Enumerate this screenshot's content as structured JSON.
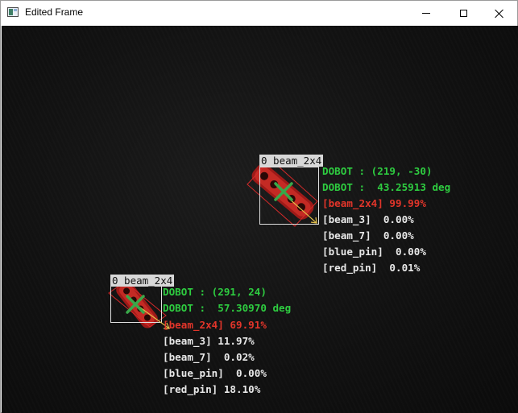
{
  "window": {
    "title": "Edited Frame",
    "icon": "app-window-icon",
    "controls": [
      "minimize-icon",
      "maximize-icon",
      "close-icon"
    ]
  },
  "colors": {
    "background": "#141414",
    "coordinate_text": "#2ecc40",
    "top_class_text": "#e2352a",
    "other_class_text": "#e8e8e8",
    "label_tag_bg": "#d8d8d8",
    "bounding_box": "#e0e0e0",
    "rotated_box": "#d42a2a",
    "center_marker": "#3aa84a"
  },
  "detections": [
    {
      "tag": "0 beam_2x4",
      "coord_line": "DOBOT : (219, -30)",
      "angle_line": "DOBOT :  43.25913 deg",
      "class_lines": [
        "[beam_2x4] 99.99%",
        "[beam_3]  0.00%",
        "[beam_7]  0.00%",
        "[blue_pin]  0.00%",
        "[red_pin]  0.01%"
      ]
    },
    {
      "tag": "0 beam_2x4",
      "coord_line": "DOBOT : (291, 24)",
      "angle_line": "DOBOT :  57.30970 deg",
      "class_lines": [
        "[beam_2x4] 69.91%",
        "[beam_3] 11.97%",
        "[beam_7]  0.02%",
        "[blue_pin]  0.00%",
        "[red_pin] 18.10%"
      ]
    }
  ]
}
